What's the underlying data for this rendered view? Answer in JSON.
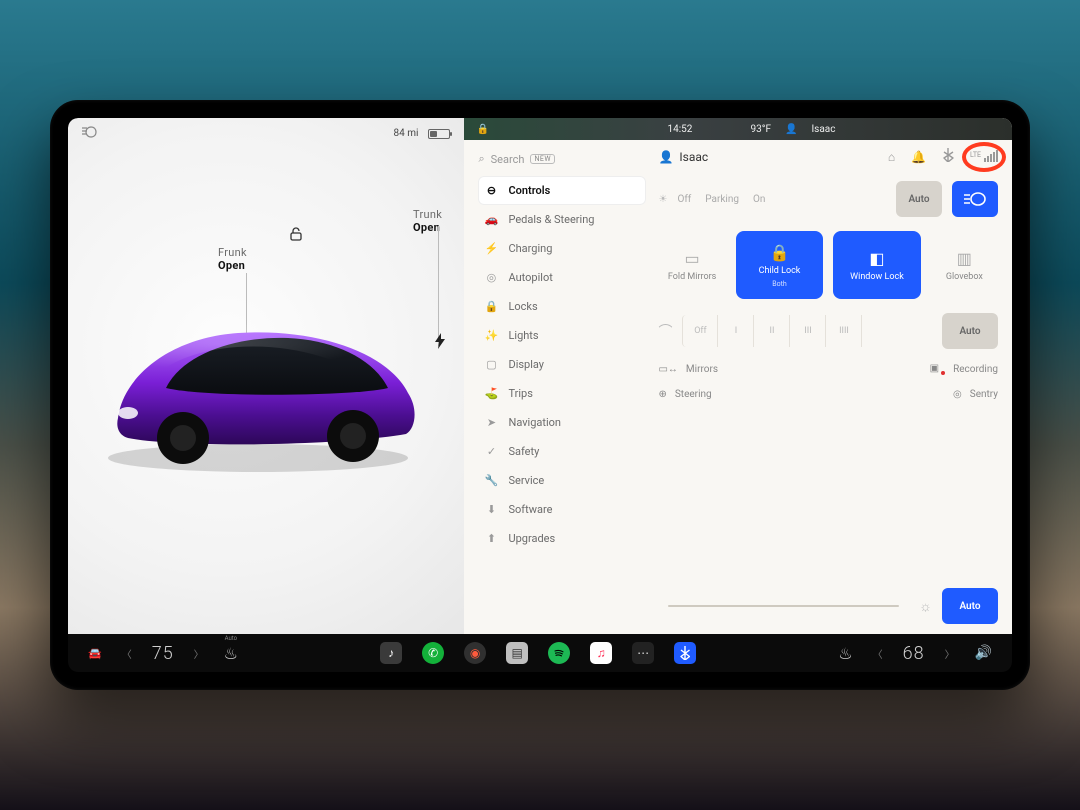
{
  "left_status": {
    "range": "84 mi"
  },
  "labels": {
    "frunk": "Frunk",
    "frunk_state": "Open",
    "trunk": "Trunk",
    "trunk_state": "Open"
  },
  "sat": {
    "time": "14:52",
    "temp": "93°F",
    "user": "Isaac"
  },
  "search": {
    "placeholder": "Search",
    "badge": "NEW"
  },
  "menu": [
    {
      "icon": "⊖",
      "label": "Controls",
      "active": true
    },
    {
      "icon": "🚗",
      "label": "Pedals & Steering"
    },
    {
      "icon": "⚡",
      "label": "Charging"
    },
    {
      "icon": "◎",
      "label": "Autopilot"
    },
    {
      "icon": "🔒",
      "label": "Locks"
    },
    {
      "icon": "✨",
      "label": "Lights"
    },
    {
      "icon": "▢",
      "label": "Display"
    },
    {
      "icon": "⛳",
      "label": "Trips"
    },
    {
      "icon": "➤",
      "label": "Navigation"
    },
    {
      "icon": "✓",
      "label": "Safety"
    },
    {
      "icon": "🔧",
      "label": "Service"
    },
    {
      "icon": "⬇",
      "label": "Software"
    },
    {
      "icon": "⬆",
      "label": "Upgrades"
    }
  ],
  "profile": "Isaac",
  "lights": {
    "off": "Off",
    "parking": "Parking",
    "on": "On",
    "auto": "Auto"
  },
  "tiles": {
    "fold": "Fold Mirrors",
    "childlock": "Child Lock",
    "childlock_sub": "Both",
    "windowlock": "Window Lock",
    "glovebox": "Glovebox"
  },
  "wiper": {
    "off": "Off",
    "auto": "Auto"
  },
  "adjust": {
    "mirrors": "Mirrors",
    "steering": "Steering",
    "recording": "Recording",
    "sentry": "Sentry"
  },
  "brightness_auto": "Auto",
  "dock": {
    "left_temp": "75",
    "right_temp": "68",
    "seat_auto": "Auto"
  },
  "signal_label": "LTE"
}
